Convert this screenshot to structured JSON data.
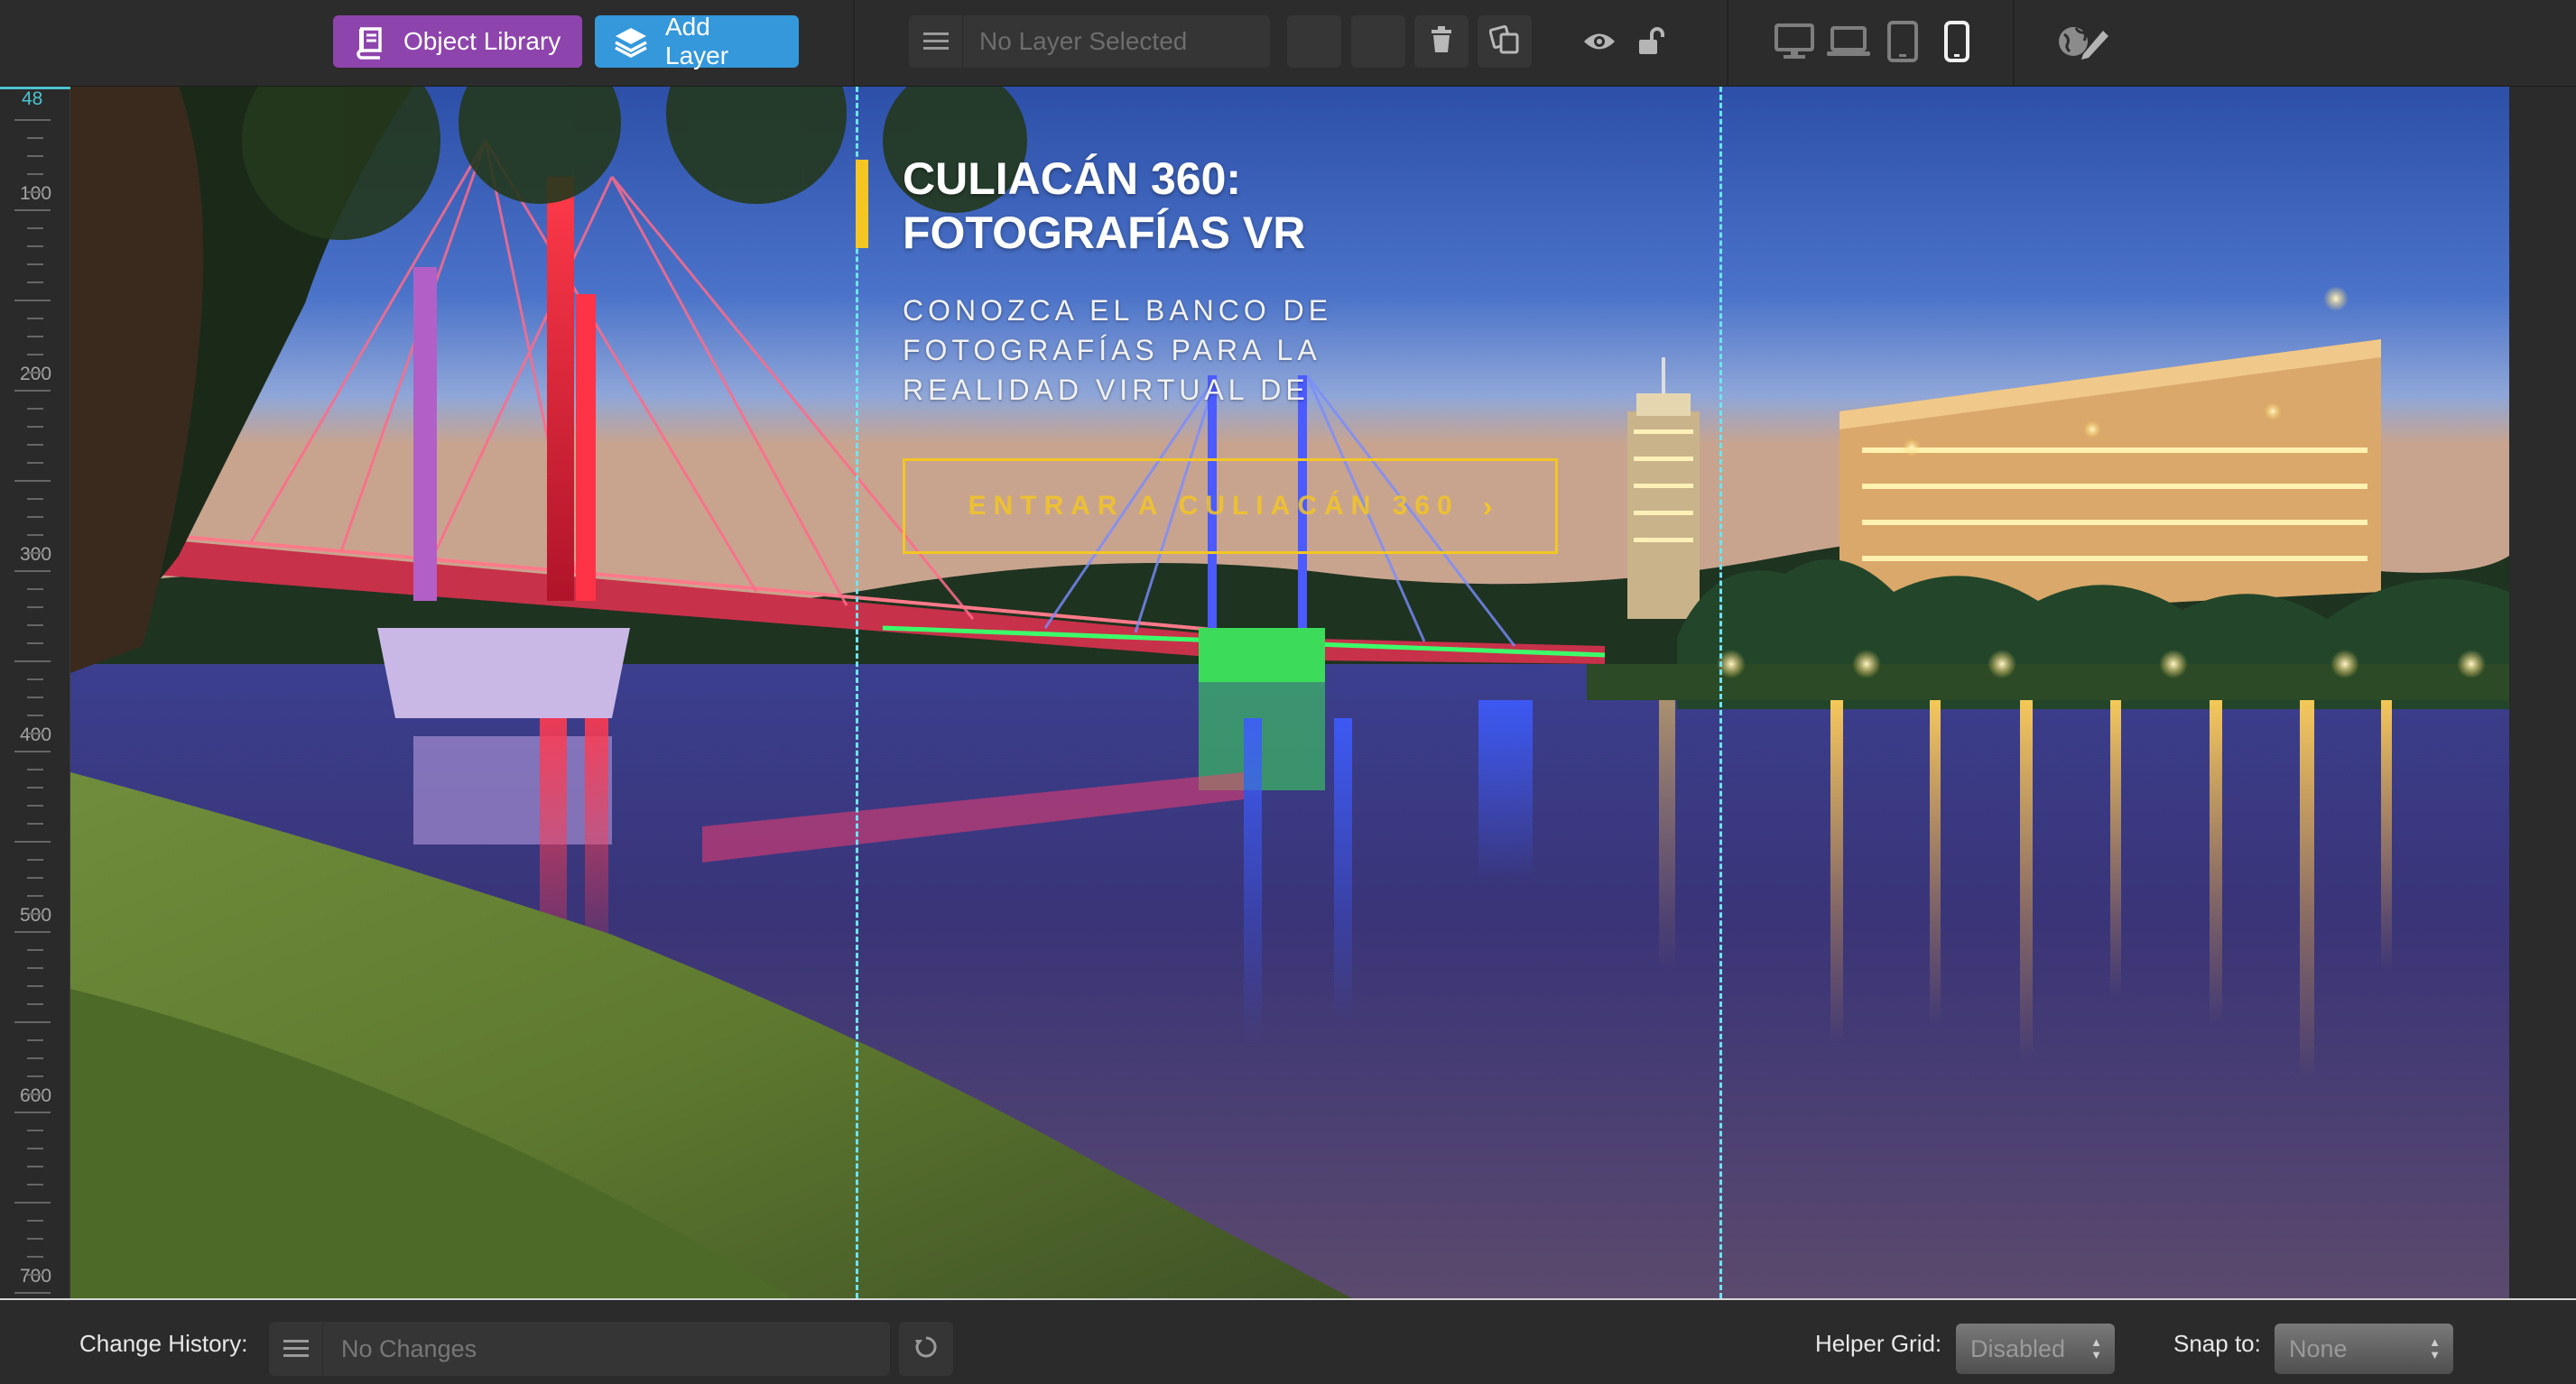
{
  "toolbar": {
    "object_library_label": "Object Library",
    "add_layer_label": "Add Layer",
    "layer_select_placeholder": "No Layer Selected",
    "icons": [
      "book-icon",
      "layers-icon",
      "menu-icon",
      "trash-icon",
      "duplicate-icon",
      "eye-icon",
      "unlock-icon",
      "desktop-icon",
      "laptop-icon",
      "tablet-icon",
      "phone-icon",
      "globe-edit-icon"
    ]
  },
  "ruler": {
    "labels": [
      "48",
      "100",
      "200",
      "300",
      "400",
      "500",
      "600",
      "700"
    ]
  },
  "slide": {
    "headline_line1": "CULIACÁN 360:",
    "headline_line2": "FOTOGRAFÍAS VR",
    "subline": "CONOZCA EL BANCO DE FOTOGRAFÍAS PARA LA REALIDAD VIRTUAL DE SINA",
    "cta_label": "ENTRAR A CULIACÁN 360",
    "cta_icon": "chevron-right-icon",
    "accent_color": "#f3c624",
    "guide_color": "#6fe3ee"
  },
  "bottombar": {
    "change_history_label": "Change History:",
    "change_history_value": "No Changes",
    "helper_grid_label": "Helper Grid:",
    "helper_grid_value": "Disabled",
    "snap_to_label": "Snap to:",
    "snap_to_value": "None"
  },
  "colors": {
    "purple_button": "#8e44ad",
    "blue_button": "#3498db",
    "toolbar_bg": "#2c2c2c"
  }
}
